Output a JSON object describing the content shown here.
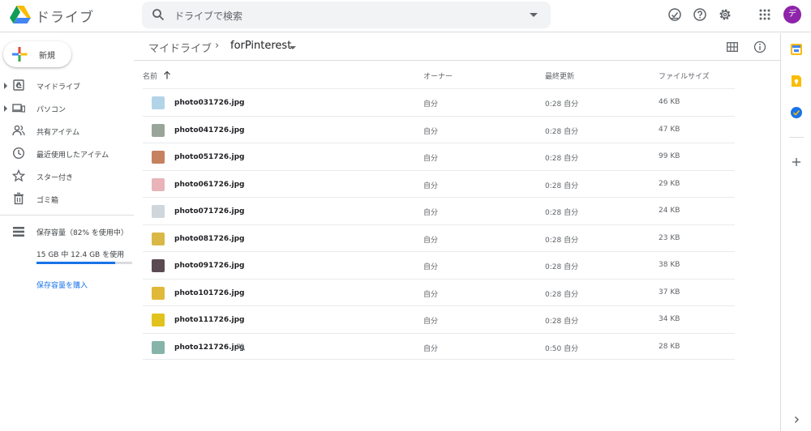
{
  "header": {
    "app_title": "ドライブ",
    "search_placeholder": "ドライブで検索",
    "avatar_letter": "デ",
    "icons": [
      "offline-icon",
      "help-icon",
      "settings-icon",
      "apps-icon"
    ]
  },
  "sidebar": {
    "new_label": "新規",
    "items": [
      {
        "label": "マイドライブ",
        "icon": "my-drive-icon",
        "expandable": true
      },
      {
        "label": "パソコン",
        "icon": "computers-icon",
        "expandable": true
      },
      {
        "label": "共有アイテム",
        "icon": "shared-icon",
        "expandable": false
      },
      {
        "label": "最近使用したアイテム",
        "icon": "recent-icon",
        "expandable": false
      },
      {
        "label": "スター付き",
        "icon": "star-icon",
        "expandable": false
      },
      {
        "label": "ゴミ箱",
        "icon": "trash-icon",
        "expandable": false
      }
    ],
    "storage": {
      "label": "保存容量（82% を使用中）",
      "usage_text": "15 GB 中 12.4 GB を使用",
      "percent": 82,
      "buy_label": "保存容量を購入"
    }
  },
  "breadcrumb": {
    "root": "マイドライブ",
    "separator": "›",
    "current": "forPinterest"
  },
  "columns": {
    "name": "名前",
    "owner": "オーナー",
    "modified": "最終更新",
    "size": "ファイルサイズ"
  },
  "files": [
    {
      "name": "photo031726.jpg",
      "owner": "自分",
      "modified": "0:28 自分",
      "size": "46 KB",
      "shared": false,
      "thumb": "#b3d4e8"
    },
    {
      "name": "photo041726.jpg",
      "owner": "自分",
      "modified": "0:28 自分",
      "size": "47 KB",
      "shared": false,
      "thumb": "#9aa59a"
    },
    {
      "name": "photo051726.jpg",
      "owner": "自分",
      "modified": "0:28 自分",
      "size": "99 KB",
      "shared": false,
      "thumb": "#c6815f"
    },
    {
      "name": "photo061726.jpg",
      "owner": "自分",
      "modified": "0:28 自分",
      "size": "29 KB",
      "shared": false,
      "thumb": "#e8b4b8"
    },
    {
      "name": "photo071726.jpg",
      "owner": "自分",
      "modified": "0:28 自分",
      "size": "24 KB",
      "shared": false,
      "thumb": "#cfd6dc"
    },
    {
      "name": "photo081726.jpg",
      "owner": "自分",
      "modified": "0:28 自分",
      "size": "23 KB",
      "shared": false,
      "thumb": "#d9b845"
    },
    {
      "name": "photo091726.jpg",
      "owner": "自分",
      "modified": "0:28 自分",
      "size": "38 KB",
      "shared": false,
      "thumb": "#5a4a52"
    },
    {
      "name": "photo101726.jpg",
      "owner": "自分",
      "modified": "0:28 自分",
      "size": "37 KB",
      "shared": false,
      "thumb": "#e0b83a"
    },
    {
      "name": "photo111726.jpg",
      "owner": "自分",
      "modified": "0:28 自分",
      "size": "34 KB",
      "shared": false,
      "thumb": "#e2c21c"
    },
    {
      "name": "photo121726.jpg",
      "owner": "自分",
      "modified": "0:50 自分",
      "size": "28 KB",
      "shared": true,
      "thumb": "#86b4a8"
    }
  ],
  "right_panel": {
    "icons": [
      "calendar-icon",
      "keep-icon",
      "tasks-icon",
      "add-icon",
      "expand-icon"
    ]
  },
  "colors": {
    "accent": "#1a73e8",
    "avatar": "#8e24aa",
    "search_bg": "#f1f3f4",
    "divider": "#dadce0"
  }
}
